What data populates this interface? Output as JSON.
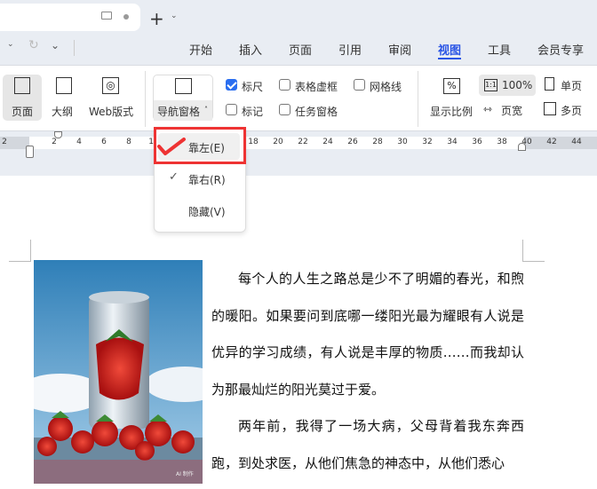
{
  "ribbon_tabs": [
    "开始",
    "插入",
    "页面",
    "引用",
    "审阅",
    "视图",
    "工具",
    "会员专享"
  ],
  "active_tab": "视图",
  "views": {
    "page": "页面",
    "outline": "大纲",
    "web": "Web版式"
  },
  "nav_pane": {
    "label": "导航窗格",
    "menu": [
      {
        "label": "靠左(E)",
        "checked": true
      },
      {
        "label": "靠右(R)",
        "checked": false
      },
      {
        "label": "隐藏(V)",
        "checked": false
      }
    ]
  },
  "checkboxes": [
    {
      "label": "标尺",
      "checked": true
    },
    {
      "label": "表格虚框",
      "checked": false
    },
    {
      "label": "网格线",
      "checked": false
    },
    {
      "label": "标记",
      "checked": false
    },
    {
      "label": "任务窗格",
      "checked": false
    }
  ],
  "zoom": {
    "ratio_label": "显示比例",
    "value": "100%",
    "page_width": "页宽",
    "single": "单页",
    "multi": "多页"
  },
  "ruler": [
    "2",
    "2",
    "4",
    "6",
    "8",
    "10",
    "18",
    "20",
    "22",
    "24",
    "26",
    "28",
    "30",
    "32",
    "34",
    "36",
    "38",
    "40",
    "42",
    "44"
  ],
  "image_caption": "AI 制作",
  "paragraphs": [
    "每个人的人生之路总是少不了明媚的春光，和煦的暖阳。如果要问到底哪一缕阳光最为耀眼有人说是优异的学习成绩，有人说是丰厚的物质……而我却认为那最灿烂的阳光莫过于爱。",
    "两年前，我得了一场大病，父母背着我东奔西跑，到处求医，从他们焦急的神态中，从他们悉心"
  ],
  "colors": {
    "accent": "#2a55e5",
    "highlight": "#ee3333"
  }
}
